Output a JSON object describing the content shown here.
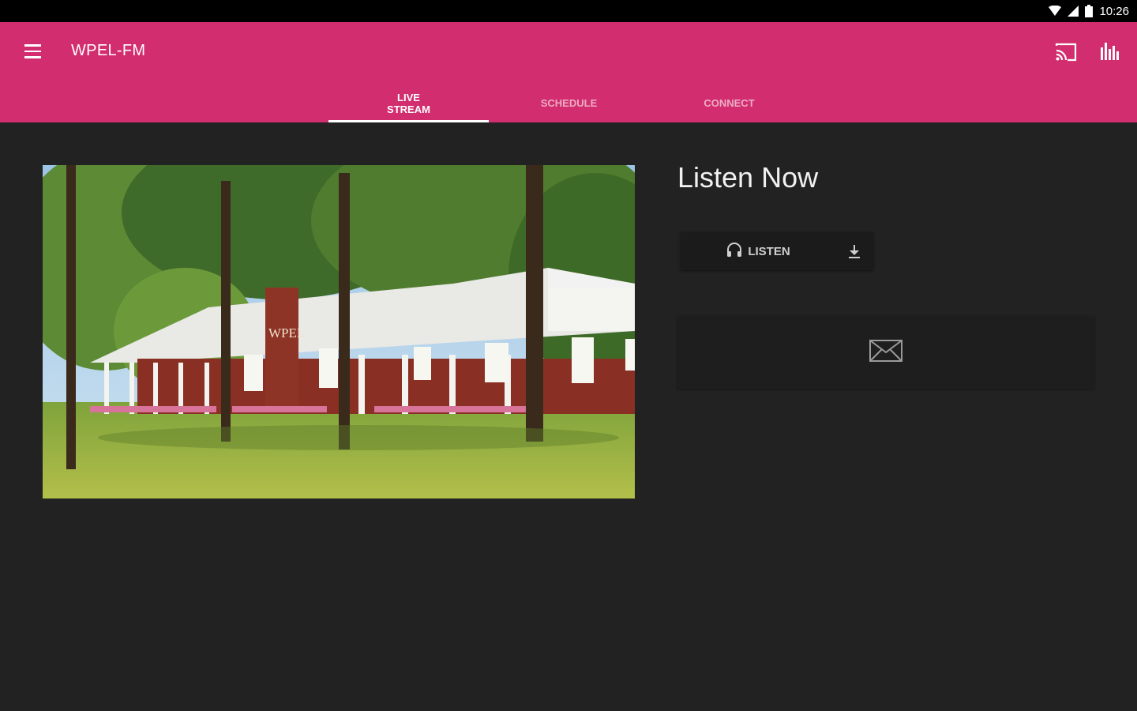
{
  "status_bar": {
    "time": "10:26",
    "icons": [
      "wifi-icon",
      "cellular-signal-icon",
      "battery-icon"
    ]
  },
  "app_bar": {
    "title": "WPEL-FM",
    "background_color": "#d22d6f",
    "left_icon": "menu-icon",
    "right_icons": [
      "cast-icon",
      "equalizer-icon"
    ]
  },
  "tabs": [
    {
      "label": "LIVE STREAM",
      "active": true
    },
    {
      "label": "SCHEDULE",
      "active": false
    },
    {
      "label": "CONNECT",
      "active": false
    }
  ],
  "main": {
    "photo": {
      "subject": "station-building-photo",
      "chimney_sign": "WPEL"
    },
    "heading": "Listen Now",
    "listen_button": {
      "label": "LISTEN",
      "icon": "headphones-icon"
    },
    "download_icon": "download-icon",
    "contact_icon": "envelope-icon"
  }
}
